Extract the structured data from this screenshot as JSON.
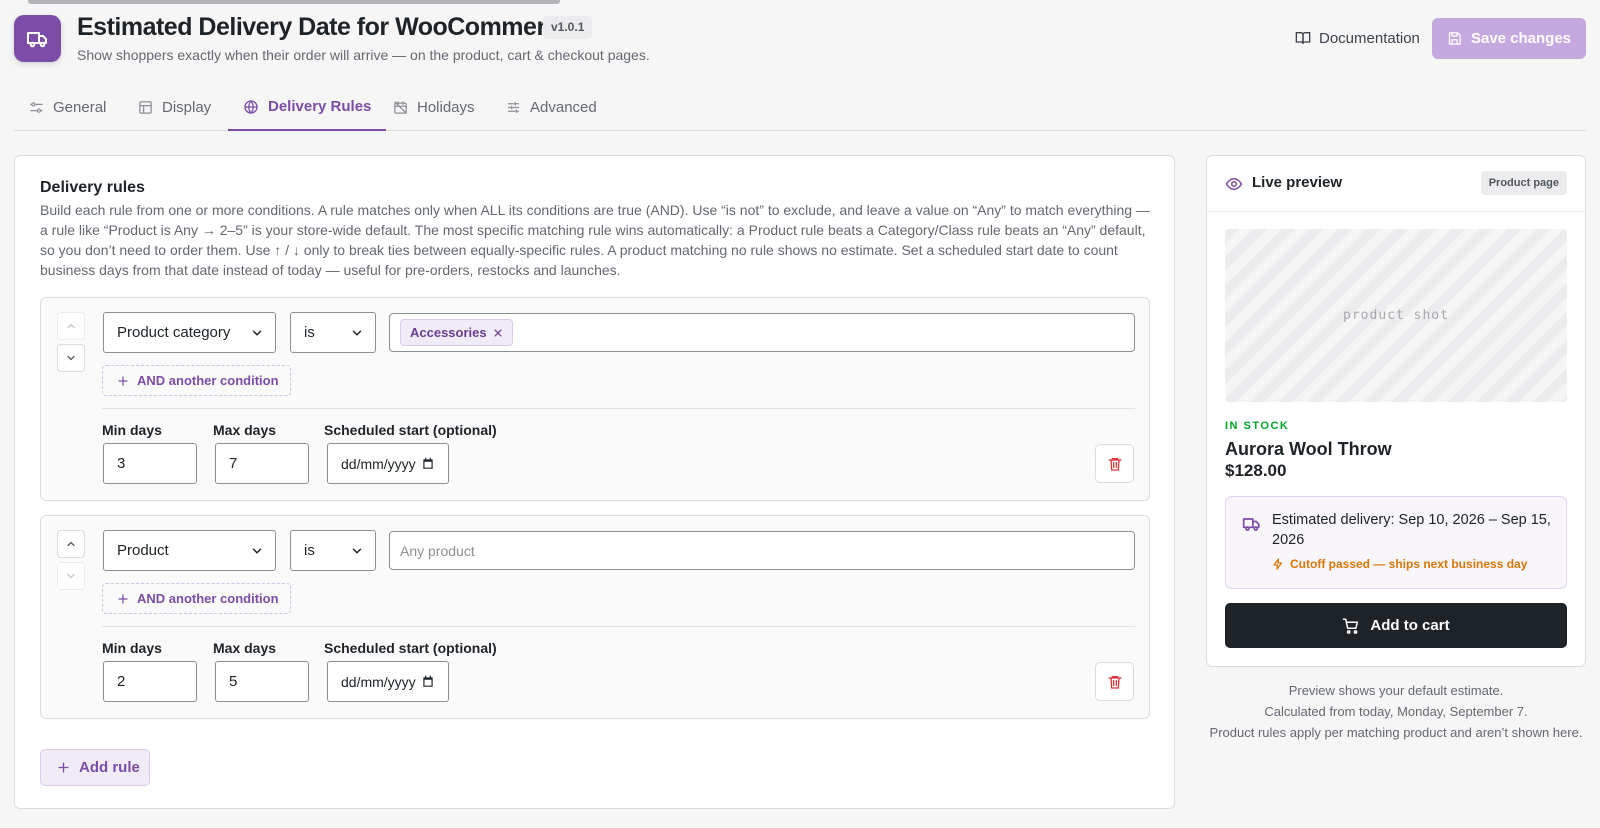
{
  "header": {
    "title": "Estimated Delivery Date for WooCommerce",
    "version": "v1.0.1",
    "subtitle": "Show shoppers exactly when their order will arrive — on the product, cart & checkout pages.",
    "documentation_label": "Documentation",
    "save_label": "Save changes",
    "icon": "truck-icon",
    "accent_color": "#7c4da6"
  },
  "tabs": [
    {
      "label": "General",
      "icon": "sliders-icon",
      "active": false
    },
    {
      "label": "Display",
      "icon": "layout-icon",
      "active": false
    },
    {
      "label": "Delivery Rules",
      "icon": "globe-icon",
      "active": true
    },
    {
      "label": "Holidays",
      "icon": "calendar-off-icon",
      "active": false
    },
    {
      "label": "Advanced",
      "icon": "settings-sliders-icon",
      "active": false
    }
  ],
  "rules_panel": {
    "title": "Delivery rules",
    "description": "Build each rule from one or more conditions. A rule matches only when ALL its conditions are true (AND). Use “is not” to exclude, and leave a value on “Any” to match everything — a rule like “Product is Any → 2–5” is your store-wide default. The most specific matching rule wins automatically: a Product rule beats a Category/Class rule beats an “Any” default, so you don’t need to order them. Use ↑ / ↓ only to break ties between equally-specific rules. A product matching no rule shows no estimate. Set a scheduled start date to count business days from that date instead of today — useful for pre-orders, restocks and launches.",
    "and_condition_label": "AND another condition",
    "min_label": "Min days",
    "max_label": "Max days",
    "start_label": "Scheduled start (optional)",
    "date_placeholder": "dd/mm/yyyy",
    "add_rule_label": "Add rule",
    "rules": [
      {
        "field": "Product category",
        "operator": "is",
        "chip": "Accessories",
        "value_placeholder": "",
        "min_days": "3",
        "max_days": "7"
      },
      {
        "field": "Product",
        "operator": "is",
        "chip": "",
        "value_placeholder": "Any product",
        "min_days": "2",
        "max_days": "5"
      }
    ]
  },
  "preview": {
    "title": "Live preview",
    "badge": "Product page",
    "image_label": "product shot",
    "stock": "IN STOCK",
    "product_name": "Aurora Wool Throw",
    "price": "$128.00",
    "estimate": "Estimated delivery: Sep 10, 2026 – Sep 15, 2026",
    "cutoff": "Cutoff passed — ships next business day",
    "cart_label": "Add to cart",
    "notes": [
      "Preview shows your default estimate.",
      "Calculated from today, Monday, September 7.",
      "Product rules apply per matching product and aren’t shown here."
    ]
  }
}
